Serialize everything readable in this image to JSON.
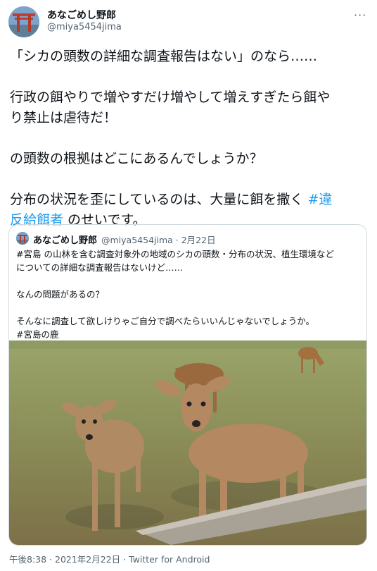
{
  "author": {
    "name": "あなごめし野郎",
    "handle": "@miya5454jima",
    "more_icon": "ellipsis-icon"
  },
  "tweet": {
    "line1": "「シカの頭数の詳細な調査報告はない」のなら……",
    "line2a": "行政の餌やりで増やすだけ増やして増えすぎたら餌や",
    "line2b": "り禁止は虐待だ！",
    "line3": "の頭数の根拠はどこにあるんでしょうか？",
    "line4a_pre": "分布の状況を歪にしているのは、大量に餌を撒く ",
    "line4a_tag": "#違",
    "line4b_tag": "反給餌者",
    "line4b_post": " のせいです。"
  },
  "quoted": {
    "name": "あなごめし野郎",
    "handle_date": "@miya5454jima · 2月22日",
    "line1": "#宮島 の山林を含む調査対象外の地域のシカの頭数・分布の状況、植生環境など",
    "line2": "についての詳細な調査報告はないけど……",
    "line3": "なんの問題があるの？",
    "line4": "そんなに調査して欲しけりゃご自分で調べたらいいんじゃないでしょうか。",
    "line5": "#宮島の鹿",
    "photo": "deer-photo"
  },
  "footer": {
    "meta": "午後8:38 · 2021年2月22日 · Twitter for Android"
  },
  "colors": {
    "link": "#1d9bf0",
    "secondary_text": "#536471",
    "border": "#cfd9de"
  }
}
